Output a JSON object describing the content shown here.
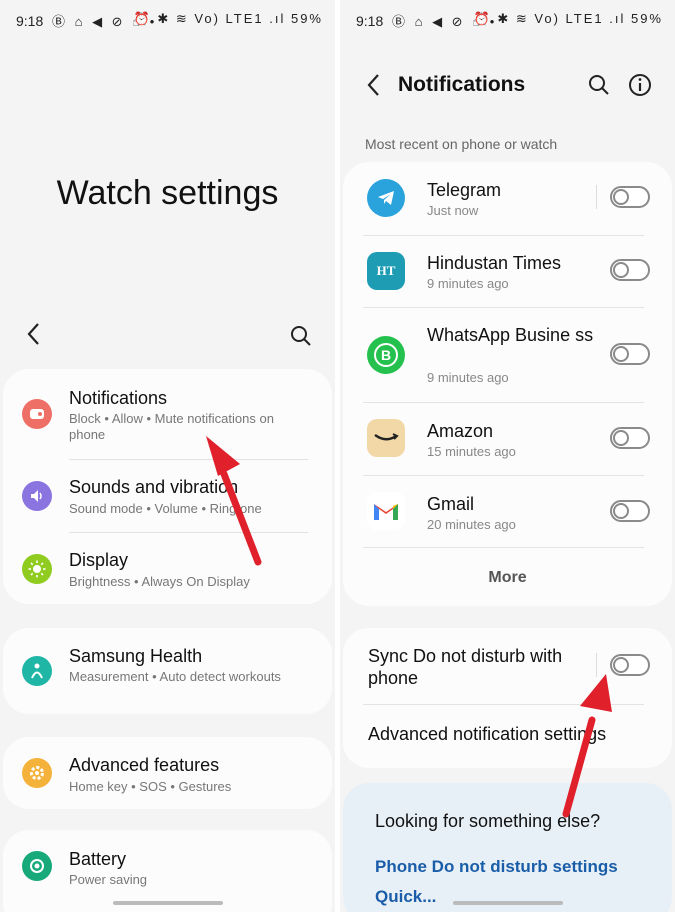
{
  "left": {
    "status": {
      "time": "9:18",
      "left_icons": "Ⓑ ⌂ ◀ ⊘ ☝ •",
      "right_icons": "⏰ ✱ ≋ Vo) LTE1 .ıl",
      "battery": "59%"
    },
    "page_title": "Watch settings",
    "back_icon": "chevron-left-icon",
    "search_icon": "search-icon",
    "groups": [
      {
        "items": [
          {
            "title": "Notifications",
            "subtitle": "Block • Allow • Mute notifications on phone",
            "icon": "bell-icon",
            "color": "#ee6f66"
          },
          {
            "title": "Sounds and vibration",
            "subtitle": "Sound mode • Volume • Ringtone",
            "icon": "speaker-icon",
            "color": "#8a74e0"
          },
          {
            "title": "Display",
            "subtitle": "Brightness • Always On Display",
            "icon": "sun-icon",
            "color": "#8fcc1f"
          }
        ]
      },
      {
        "items": [
          {
            "title": "Samsung Health",
            "subtitle": "Measurement • Auto detect workouts",
            "icon": "health-icon",
            "color": "#1fb6a6"
          }
        ]
      },
      {
        "items": [
          {
            "title": "Advanced features",
            "subtitle": "Home key • SOS • Gestures",
            "icon": "gear-icon",
            "color": "#f4b23a"
          }
        ]
      },
      {
        "items": [
          {
            "title": "Battery",
            "subtitle": "Power saving",
            "icon": "battery-icon",
            "color": "#17a97a"
          }
        ]
      }
    ]
  },
  "right": {
    "status": {
      "time": "9:18",
      "left_icons": "Ⓑ ⌂ ◀ ⊘ ☝ •",
      "right_icons": "⏰ ✱ ≋ Vo) LTE1 .ıl",
      "battery": "59%"
    },
    "title": "Notifications",
    "section_label": "Most recent on phone or watch",
    "apps": [
      {
        "name": "Telegram",
        "time": "Just now",
        "icon": "telegram-icon",
        "color": "#2aa3dc",
        "glyph": "➤",
        "enabled": false
      },
      {
        "name": "Hindustan Times",
        "time": "9 minutes ago",
        "icon": "hindustan-times-icon",
        "color": "#1d9cb4",
        "glyph": "HT",
        "enabled": false
      },
      {
        "name": "WhatsApp Busine ss",
        "time": "9 minutes ago",
        "icon": "whatsapp-business-icon",
        "color": "#25c14e",
        "glyph": "B",
        "enabled": false
      },
      {
        "name": "Amazon",
        "time": "15 minutes ago",
        "icon": "amazon-icon",
        "color": "#f2d8a6",
        "glyph": "⌣",
        "enabled": false
      },
      {
        "name": "Gmail",
        "time": "20 minutes ago",
        "icon": "gmail-icon",
        "color": "#ffffff",
        "glyph": "M",
        "enabled": false
      }
    ],
    "more_label": "More",
    "sync_label": "Sync Do not disturb with phone",
    "sync_enabled": false,
    "advanced_label": "Advanced notification settings",
    "looking_title": "Looking for something else?",
    "looking_link": "Phone Do not disturb settings",
    "looking_link2": "Quick..."
  },
  "colors": {
    "accent_link": "#1a5da8",
    "arrow_red": "#e0202a",
    "panel_bg": "#f4f4f4"
  }
}
